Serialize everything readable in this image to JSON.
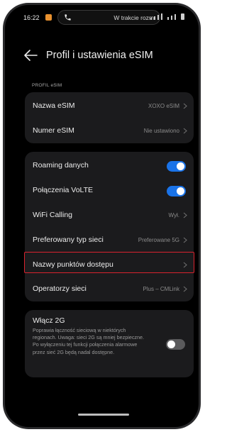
{
  "status_bar": {
    "time": "16:22",
    "call_text": "W trakcie rozm"
  },
  "header": {
    "title": "Profil i ustawienia eSIM"
  },
  "section_label": "PROFIL eSIM",
  "profile": [
    {
      "label": "Nazwa eSIM",
      "value": "XOXO eSIM"
    },
    {
      "label": "Numer eSIM",
      "value": "Nie ustawiono"
    }
  ],
  "network": {
    "roaming": {
      "label": "Roaming danych",
      "enabled": true
    },
    "volte": {
      "label": "Połączenia VoLTE",
      "enabled": true
    },
    "wifi_calling": {
      "label": "WiFi Calling",
      "value": "Wył."
    },
    "network_type": {
      "label": "Preferowany typ sieci",
      "value": "Preferowane 5G"
    },
    "apn": {
      "label": "Nazwy punktów dostępu",
      "value": ""
    },
    "operators": {
      "label": "Operatorzy sieci",
      "value": "Plus – CMLink"
    }
  },
  "enable_2g": {
    "title": "Włącz 2G",
    "description": "Poprawia łączność sieciową w niektórych regionach. Uwaga: sieci 2G są mniej bezpieczne. Po wyłączeniu tej funkcji połączenia alarmowe przez sieć 2G będą nadal dostępne.",
    "enabled": false
  },
  "colors": {
    "accent": "#1a73e8",
    "highlight": "#d9232e",
    "card_bg": "#1b1b1d"
  }
}
